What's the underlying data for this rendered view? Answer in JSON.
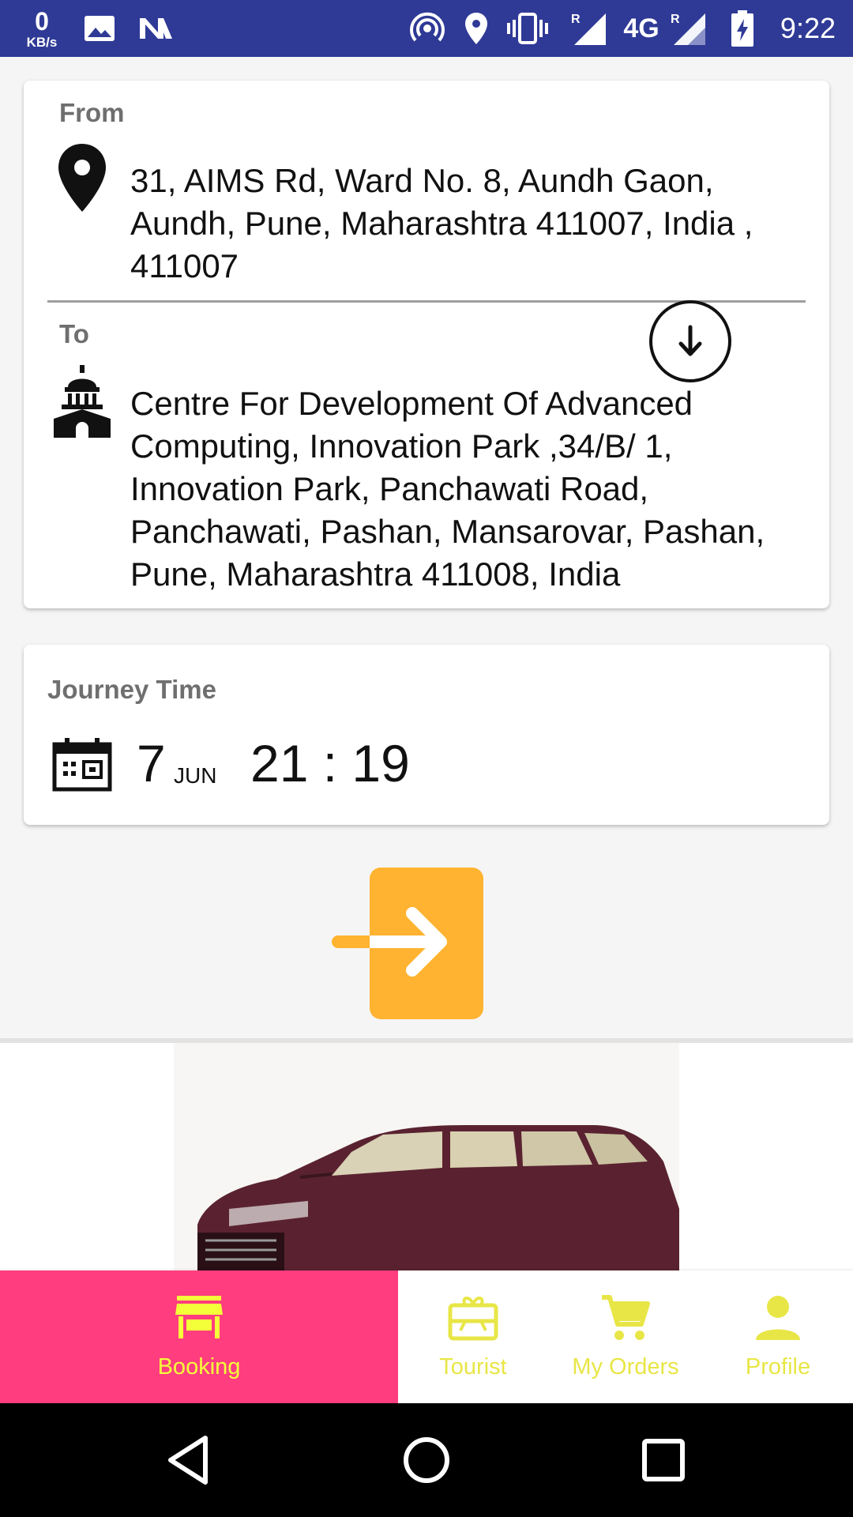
{
  "status_bar": {
    "speed_value": "0",
    "speed_unit": "KB/s",
    "network_label": "4G",
    "time": "9:22"
  },
  "route": {
    "from_label": "From",
    "from_address": "31, AIMS Rd, Ward No. 8, Aundh Gaon, Aundh, Pune, Maharashtra 411007, India , 411007",
    "to_label": "To",
    "to_address": "Centre For Development Of Advanced Computing, Innovation Park ,34/B/ 1, Innovation Park, Panchawati Road, Panchawati, Pashan, Mansarovar, Pashan, Pune, Maharashtra 411008, India"
  },
  "journey": {
    "label": "Journey Time",
    "day": "7",
    "month": "JUN",
    "time": "21 : 19"
  },
  "bottom_nav": {
    "items": [
      {
        "label": "Booking",
        "icon": "store-icon",
        "active": true
      },
      {
        "label": "Tourist",
        "icon": "gift-card-icon",
        "active": false
      },
      {
        "label": "My Orders",
        "icon": "cart-icon",
        "active": false
      },
      {
        "label": "Profile",
        "icon": "person-icon",
        "active": false
      }
    ]
  },
  "colors": {
    "status_bar": "#2f3a96",
    "accent_orange": "#ffb330",
    "nav_active_bg": "#ff3d7f",
    "nav_text": "#f4ff3a"
  }
}
